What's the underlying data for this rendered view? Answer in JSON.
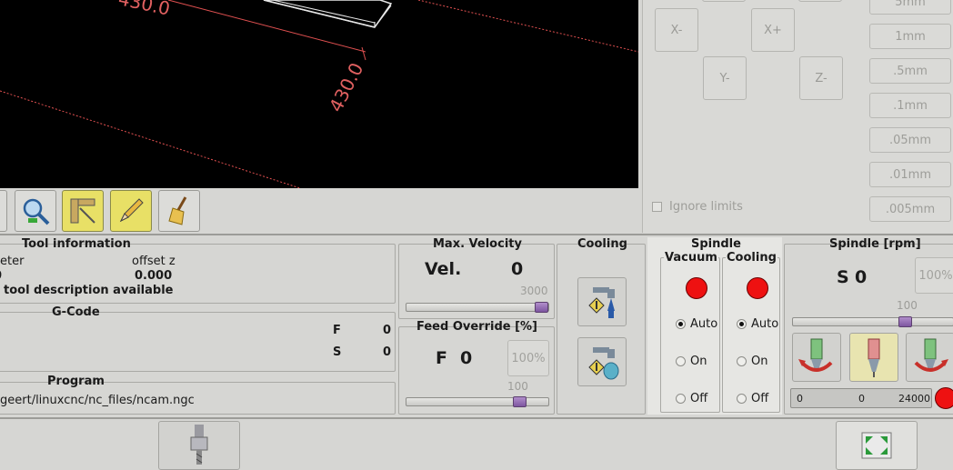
{
  "preview": {
    "dimension_top": "430.0",
    "dimension_right": "430.0"
  },
  "toolbar": {
    "buttons": [
      {
        "icon": "partial-button-icon"
      },
      {
        "icon": "zoom-icon"
      },
      {
        "icon": "ruler-measure-icon",
        "active": true
      },
      {
        "icon": "pencil-icon",
        "active": true
      },
      {
        "icon": "broom-clear-icon"
      }
    ]
  },
  "jog": {
    "x_minus": "X-",
    "x_plus": "X+",
    "y_minus": "Y-",
    "z_minus": "Z-",
    "increments": [
      "5mm",
      "1mm",
      ".5mm",
      ".1mm",
      ".05mm",
      ".01mm",
      ".005mm"
    ],
    "ignore_limits": "Ignore limits"
  },
  "tool_info": {
    "title": "Tool information",
    "diameter_label": "eter",
    "offset_z_label": "offset z",
    "diameter_value": "0",
    "offset_z_value": "0.000",
    "description": "tool description available"
  },
  "gcode": {
    "title": "G-Code",
    "f_label": "F",
    "f_value": "0",
    "s_label": "S",
    "s_value": "0"
  },
  "program": {
    "title": "Program",
    "path": "geert/linuxcnc/nc_files/ncam.ngc"
  },
  "max_velocity": {
    "title": "Max. Velocity",
    "label": "Vel.",
    "value": "0",
    "slider_max": "3000",
    "slider_fraction": 1.0
  },
  "feed_override": {
    "title": "Feed Override [%]",
    "label": "F",
    "value": "0",
    "button": "100%",
    "slider_value": "100",
    "slider_fraction": 0.83
  },
  "cooling": {
    "title": "Cooling",
    "buttons": [
      {
        "icon": "coolant-flood-icon"
      },
      {
        "icon": "coolant-mist-icon"
      }
    ]
  },
  "spindle": {
    "title": "Spindle",
    "vacuum": {
      "title": "Vacuum",
      "options": [
        "Auto",
        "On",
        "Off"
      ],
      "selected": "Auto"
    },
    "cooling": {
      "title": "Cooling",
      "options": [
        "Auto",
        "On",
        "Off"
      ],
      "selected": "Auto"
    },
    "led_color": "#ee1111"
  },
  "spindle_rpm": {
    "title": "Spindle [rpm]",
    "label": "S",
    "value": "0",
    "button": "100%",
    "slider_value": "100",
    "slider_fraction": 0.72,
    "buttons": [
      {
        "icon": "spindle-ccw-icon"
      },
      {
        "icon": "spindle-stop-icon"
      },
      {
        "icon": "spindle-cw-icon"
      }
    ],
    "bar_min": "0",
    "bar_value": "0",
    "bar_max": "24000"
  },
  "bottom_bar": {
    "buttons": [
      {
        "icon": "tool-change-icon"
      },
      {
        "icon": "fullscreen-icon"
      }
    ]
  }
}
